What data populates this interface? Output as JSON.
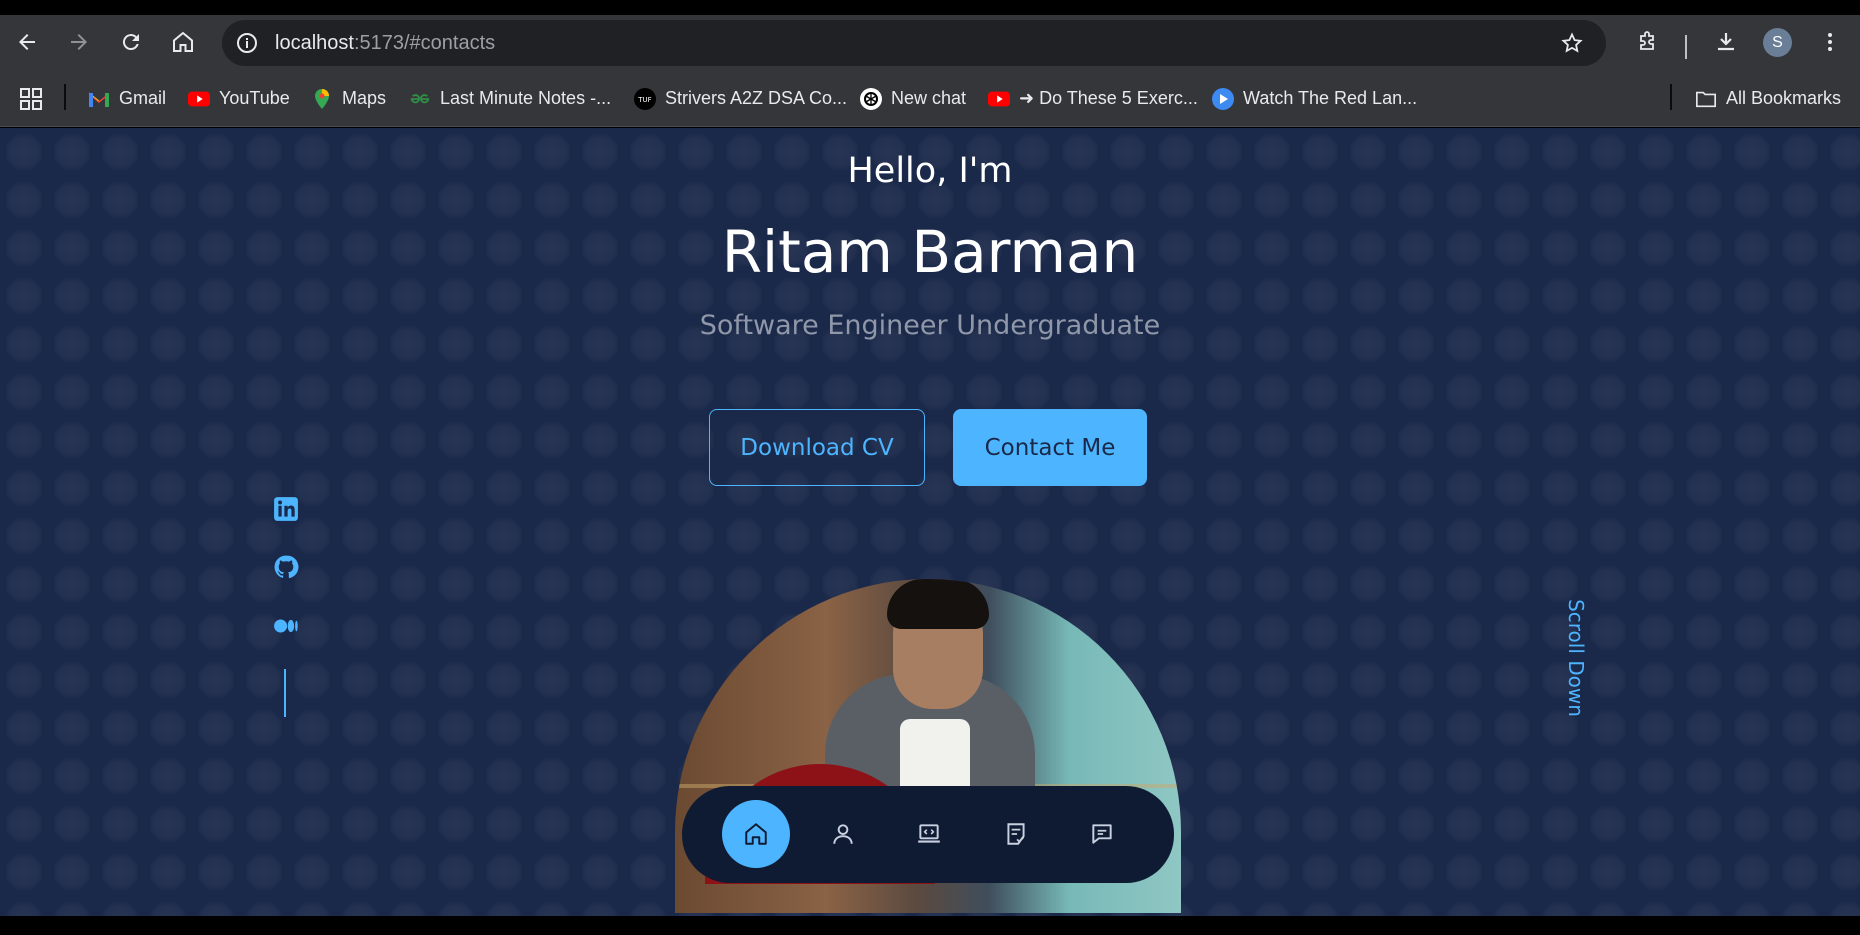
{
  "browser": {
    "url_host": "localhost",
    "url_rest": ":5173/#contacts",
    "profile_initial": "S",
    "bookmarks": [
      {
        "label": "Gmail",
        "icon": "gmail-icon"
      },
      {
        "label": "YouTube",
        "icon": "youtube-icon"
      },
      {
        "label": "Maps",
        "icon": "maps-icon"
      },
      {
        "label": "Last Minute Notes -...",
        "icon": "gfg-icon"
      },
      {
        "label": "Strivers A2Z DSA Co...",
        "icon": "tuf-icon"
      },
      {
        "label": "New chat",
        "icon": "openai-icon"
      },
      {
        "label": "➜ Do These 5 Exerc...",
        "icon": "youtube-icon"
      },
      {
        "label": "Watch The Red Lan...",
        "icon": "play-icon"
      }
    ],
    "all_bookmarks": "All Bookmarks"
  },
  "hero": {
    "greeting": "Hello, I'm",
    "name": "Ritam Barman",
    "role": "Software Engineer Undergraduate",
    "download_cv": "Download CV",
    "contact_me": "Contact Me",
    "scroll_down": "Scroll Down"
  },
  "social": [
    {
      "name": "linkedin-icon"
    },
    {
      "name": "github-icon"
    },
    {
      "name": "medium-icon"
    }
  ],
  "dock": {
    "items": [
      "home-icon",
      "user-icon",
      "laptop-code-icon",
      "checklist-icon",
      "message-icon"
    ],
    "active": "home-icon"
  },
  "colors": {
    "accent": "#4db5ff",
    "page_bg": "#1a2849",
    "dock_bg": "#0f1b33",
    "chrome": "#35363a"
  }
}
